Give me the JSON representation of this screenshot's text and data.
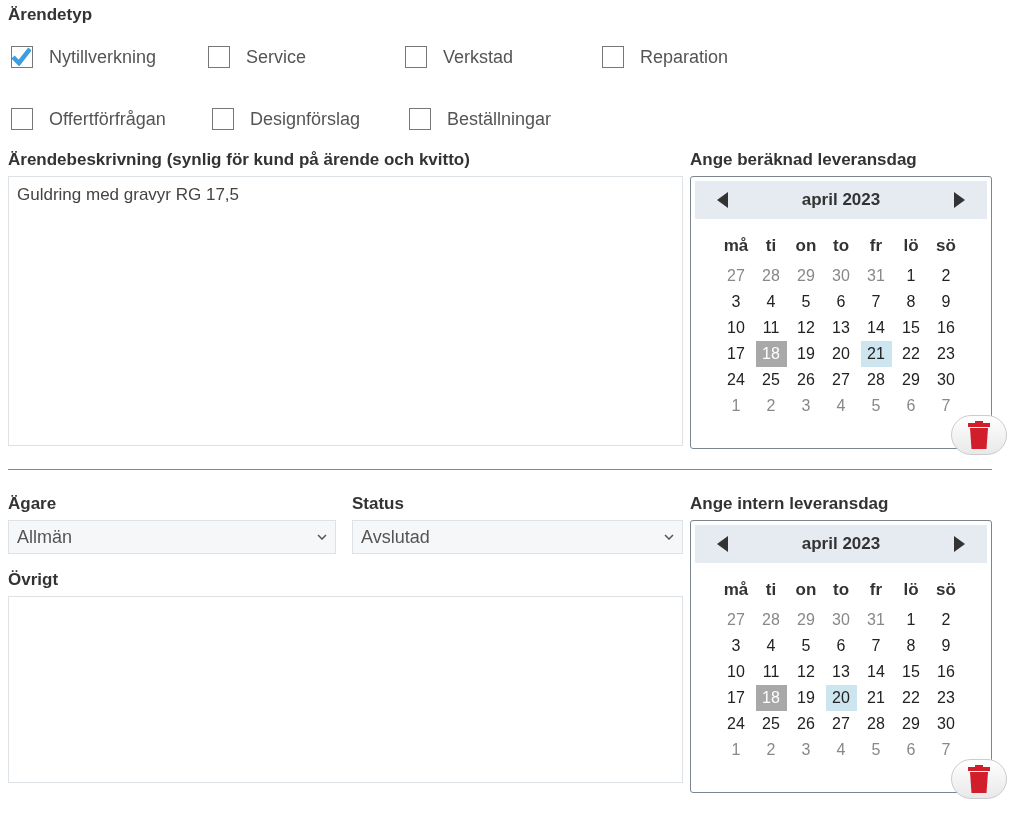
{
  "case_type": {
    "title": "Ärendetyp",
    "rows": [
      [
        {
          "label": "Nytillverkning",
          "checked": true
        },
        {
          "label": "Service",
          "checked": false
        },
        {
          "label": "Verkstad",
          "checked": false
        },
        {
          "label": "Reparation",
          "checked": false
        }
      ],
      [
        {
          "label": "Offertförfrågan",
          "checked": false
        },
        {
          "label": "Designförslag",
          "checked": false
        },
        {
          "label": "Beställningar",
          "checked": false
        }
      ]
    ]
  },
  "description": {
    "label": "Ärendebeskrivning (synlig för kund på ärende och kvitto)",
    "value": "Guldring med gravyr RG 17,5"
  },
  "owner": {
    "label": "Ägare",
    "value": "Allmän"
  },
  "status": {
    "label": "Status",
    "value": "Avslutad"
  },
  "other": {
    "label": "Övrigt"
  },
  "calendars": [
    {
      "label": "Ange beräknad leveransdag",
      "month": "april 2023",
      "weekdays": [
        "må",
        "ti",
        "on",
        "to",
        "fr",
        "lö",
        "sö"
      ],
      "days": [
        {
          "d": "27",
          "kind": "other",
          "selected": false
        },
        {
          "d": "28",
          "kind": "other",
          "selected": false
        },
        {
          "d": "29",
          "kind": "other",
          "selected": false
        },
        {
          "d": "30",
          "kind": "other",
          "selected": false
        },
        {
          "d": "31",
          "kind": "other",
          "selected": false
        },
        {
          "d": "1",
          "kind": "day",
          "selected": false
        },
        {
          "d": "2",
          "kind": "day",
          "selected": false
        },
        {
          "d": "3",
          "kind": "day",
          "selected": false
        },
        {
          "d": "4",
          "kind": "day",
          "selected": false
        },
        {
          "d": "5",
          "kind": "day",
          "selected": false
        },
        {
          "d": "6",
          "kind": "day",
          "selected": false
        },
        {
          "d": "7",
          "kind": "day",
          "selected": false
        },
        {
          "d": "8",
          "kind": "day",
          "selected": false
        },
        {
          "d": "9",
          "kind": "day",
          "selected": false
        },
        {
          "d": "10",
          "kind": "day",
          "selected": false
        },
        {
          "d": "11",
          "kind": "day",
          "selected": false
        },
        {
          "d": "12",
          "kind": "day",
          "selected": false
        },
        {
          "d": "13",
          "kind": "day",
          "selected": false
        },
        {
          "d": "14",
          "kind": "day",
          "selected": false
        },
        {
          "d": "15",
          "kind": "day",
          "selected": false
        },
        {
          "d": "16",
          "kind": "day",
          "selected": false
        },
        {
          "d": "17",
          "kind": "day",
          "selected": false
        },
        {
          "d": "18",
          "kind": "today",
          "selected": false
        },
        {
          "d": "19",
          "kind": "day",
          "selected": false
        },
        {
          "d": "20",
          "kind": "day",
          "selected": false
        },
        {
          "d": "21",
          "kind": "day",
          "selected": true
        },
        {
          "d": "22",
          "kind": "day",
          "selected": false
        },
        {
          "d": "23",
          "kind": "day",
          "selected": false
        },
        {
          "d": "24",
          "kind": "day",
          "selected": false
        },
        {
          "d": "25",
          "kind": "day",
          "selected": false
        },
        {
          "d": "26",
          "kind": "day",
          "selected": false
        },
        {
          "d": "27",
          "kind": "day",
          "selected": false
        },
        {
          "d": "28",
          "kind": "day",
          "selected": false
        },
        {
          "d": "29",
          "kind": "day",
          "selected": false
        },
        {
          "d": "30",
          "kind": "day",
          "selected": false
        },
        {
          "d": "1",
          "kind": "other",
          "selected": false
        },
        {
          "d": "2",
          "kind": "other",
          "selected": false
        },
        {
          "d": "3",
          "kind": "other",
          "selected": false
        },
        {
          "d": "4",
          "kind": "other",
          "selected": false
        },
        {
          "d": "5",
          "kind": "other",
          "selected": false
        },
        {
          "d": "6",
          "kind": "other",
          "selected": false
        },
        {
          "d": "7",
          "kind": "other",
          "selected": false
        }
      ]
    },
    {
      "label": "Ange intern leveransdag",
      "month": "april 2023",
      "weekdays": [
        "må",
        "ti",
        "on",
        "to",
        "fr",
        "lö",
        "sö"
      ],
      "days": [
        {
          "d": "27",
          "kind": "other",
          "selected": false
        },
        {
          "d": "28",
          "kind": "other",
          "selected": false
        },
        {
          "d": "29",
          "kind": "other",
          "selected": false
        },
        {
          "d": "30",
          "kind": "other",
          "selected": false
        },
        {
          "d": "31",
          "kind": "other",
          "selected": false
        },
        {
          "d": "1",
          "kind": "day",
          "selected": false
        },
        {
          "d": "2",
          "kind": "day",
          "selected": false
        },
        {
          "d": "3",
          "kind": "day",
          "selected": false
        },
        {
          "d": "4",
          "kind": "day",
          "selected": false
        },
        {
          "d": "5",
          "kind": "day",
          "selected": false
        },
        {
          "d": "6",
          "kind": "day",
          "selected": false
        },
        {
          "d": "7",
          "kind": "day",
          "selected": false
        },
        {
          "d": "8",
          "kind": "day",
          "selected": false
        },
        {
          "d": "9",
          "kind": "day",
          "selected": false
        },
        {
          "d": "10",
          "kind": "day",
          "selected": false
        },
        {
          "d": "11",
          "kind": "day",
          "selected": false
        },
        {
          "d": "12",
          "kind": "day",
          "selected": false
        },
        {
          "d": "13",
          "kind": "day",
          "selected": false
        },
        {
          "d": "14",
          "kind": "day",
          "selected": false
        },
        {
          "d": "15",
          "kind": "day",
          "selected": false
        },
        {
          "d": "16",
          "kind": "day",
          "selected": false
        },
        {
          "d": "17",
          "kind": "day",
          "selected": false
        },
        {
          "d": "18",
          "kind": "today",
          "selected": false
        },
        {
          "d": "19",
          "kind": "day",
          "selected": false
        },
        {
          "d": "20",
          "kind": "day",
          "selected": true
        },
        {
          "d": "21",
          "kind": "day",
          "selected": false
        },
        {
          "d": "22",
          "kind": "day",
          "selected": false
        },
        {
          "d": "23",
          "kind": "day",
          "selected": false
        },
        {
          "d": "24",
          "kind": "day",
          "selected": false
        },
        {
          "d": "25",
          "kind": "day",
          "selected": false
        },
        {
          "d": "26",
          "kind": "day",
          "selected": false
        },
        {
          "d": "27",
          "kind": "day",
          "selected": false
        },
        {
          "d": "28",
          "kind": "day",
          "selected": false
        },
        {
          "d": "29",
          "kind": "day",
          "selected": false
        },
        {
          "d": "30",
          "kind": "day",
          "selected": false
        },
        {
          "d": "1",
          "kind": "other",
          "selected": false
        },
        {
          "d": "2",
          "kind": "other",
          "selected": false
        },
        {
          "d": "3",
          "kind": "other",
          "selected": false
        },
        {
          "d": "4",
          "kind": "other",
          "selected": false
        },
        {
          "d": "5",
          "kind": "other",
          "selected": false
        },
        {
          "d": "6",
          "kind": "other",
          "selected": false
        },
        {
          "d": "7",
          "kind": "other",
          "selected": false
        }
      ]
    }
  ]
}
